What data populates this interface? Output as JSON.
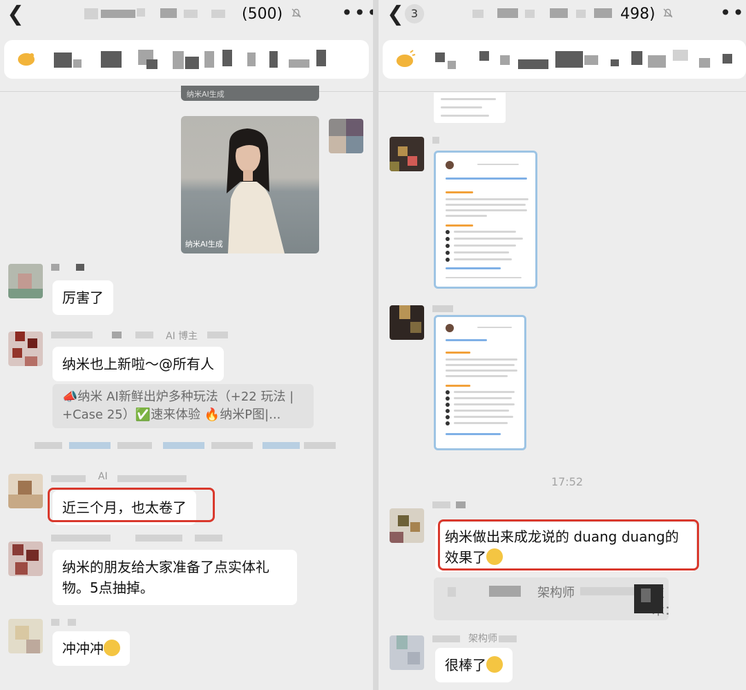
{
  "left_chat": {
    "title": "(500)",
    "image_caption": "纳米AI生成",
    "image_caption_top": "纳米AI生成",
    "messages": {
      "m1": "厉害了",
      "name2": "AI 博主",
      "m2": "纳米也上新啦～@所有人",
      "quote2": "📣纳米 AI新鲜出炉多种玩法（+22 玩法 | +Case 25）✅速来体验 🔥纳米P图|...",
      "name3": "AI",
      "m3": "近三个月，也太卷了",
      "m4": "纳米的朋友给大家准备了点实体礼物。5点抽掉。",
      "m5": "冲冲冲"
    }
  },
  "right_chat": {
    "back_badge": "3",
    "title": "498)",
    "time": "17:52",
    "messages": {
      "m1": "纳米做出来成龙说的 duang duang的效果了",
      "quote1_a": "架构师",
      "quote1_b": "技术：",
      "name2": "架构师",
      "m2": "很棒了"
    }
  },
  "colors": {
    "background": "#ededed",
    "bubble": "#ffffff",
    "highlight_border": "#d9382c",
    "quote_bg": "#e2e2e2",
    "doc_border": "#9dc4e4"
  },
  "icons": [
    "back-chevron-icon",
    "mute-bell-icon",
    "more-dots-icon",
    "announcement-icon",
    "emoji-pleading-icon",
    "emoji-smile-icon",
    "emoji-thumbs-up-icon"
  ]
}
